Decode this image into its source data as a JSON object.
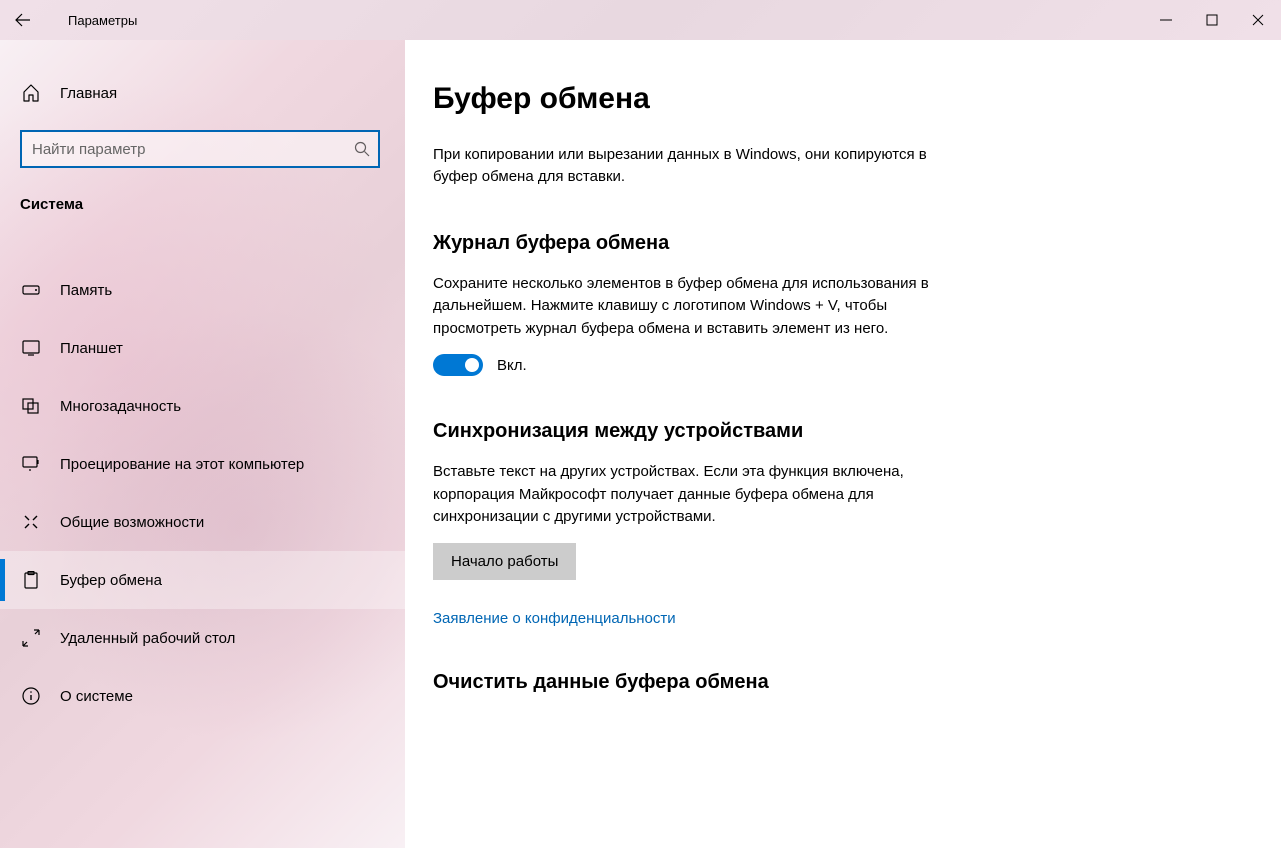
{
  "window": {
    "title": "Параметры"
  },
  "sidebar": {
    "home": "Главная",
    "search_placeholder": "Найти параметр",
    "category": "Система",
    "items": [
      {
        "label": "Память"
      },
      {
        "label": "Планшет"
      },
      {
        "label": "Многозадачность"
      },
      {
        "label": "Проецирование на этот компьютер"
      },
      {
        "label": "Общие возможности"
      },
      {
        "label": "Буфер обмена"
      },
      {
        "label": "Удаленный рабочий стол"
      },
      {
        "label": "О системе"
      }
    ]
  },
  "page": {
    "title": "Буфер обмена",
    "intro": "При копировании или вырезании данных в Windows, они копируются в буфер обмена для вставки.",
    "section1": {
      "title": "Журнал буфера обмена",
      "desc": "Сохраните несколько элементов в буфер обмена для использования в дальнейшем. Нажмите клавишу с логотипом Windows + V, чтобы просмотреть журнал буфера обмена и вставить элемент из него.",
      "toggle_label": "Вкл."
    },
    "section2": {
      "title": "Синхронизация между устройствами",
      "desc": "Вставьте текст на других устройствах. Если эта функция включена, корпорация Майкрософт получает данные буфера обмена для синхронизации с другими устройствами.",
      "button": "Начало работы"
    },
    "privacy_link": "Заявление о конфиденциальности",
    "section3": {
      "title": "Очистить данные буфера обмена"
    }
  }
}
